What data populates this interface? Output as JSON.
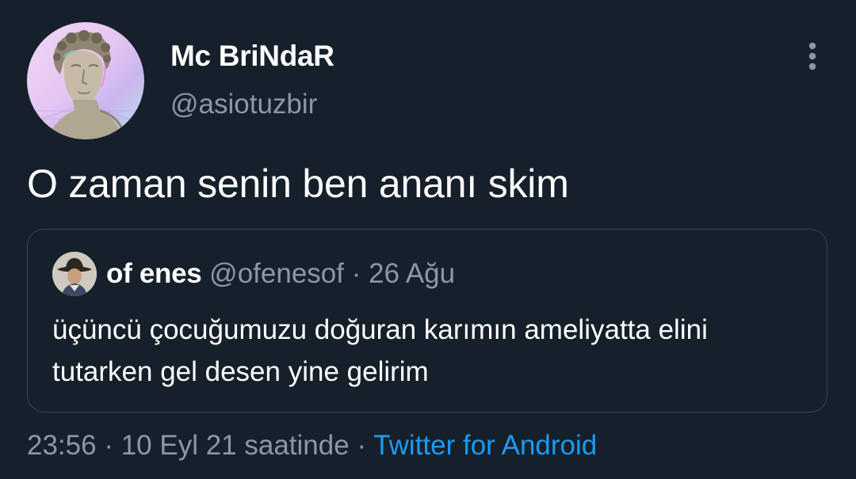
{
  "tweet": {
    "author": {
      "display_name": "Mc BriNdaR",
      "handle": "@asiotuzbir",
      "avatar_icon": "statue-bust-avatar"
    },
    "more_icon": "vertical-ellipsis-icon",
    "text": "O zaman senin ben ananı skim",
    "quoted": {
      "display_name": "of enes",
      "handle": "@ofenesof",
      "separator": "·",
      "date": "26 Ağu",
      "avatar_icon": "cowboy-hat-avatar",
      "text": "üçüncü çocuğumuzu doğuran karımın ameliyatta elini tutarken gel desen yine gelirim"
    },
    "meta": {
      "time": "23:56",
      "separator_1": "·",
      "date": "10 Eyl 21 saatinde",
      "separator_2": "·",
      "source": "Twitter for Android"
    }
  },
  "colors": {
    "background": "#15202b",
    "primary_text": "#ffffff",
    "secondary_text": "#8b98a5",
    "link": "#1d9bf0",
    "border": "#38444d"
  }
}
